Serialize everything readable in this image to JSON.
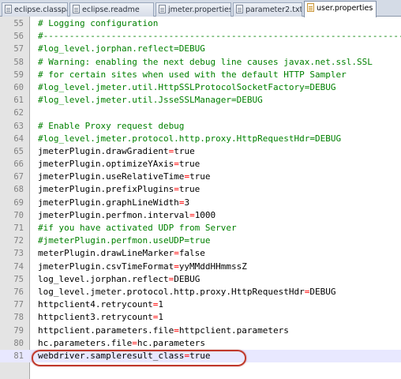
{
  "tabs": [
    {
      "label": "eclipse.classpath",
      "icon": "text-file-icon"
    },
    {
      "label": "eclipse.readme",
      "icon": "text-file-icon"
    },
    {
      "label": "jmeter.properties",
      "icon": "text-file-icon"
    },
    {
      "label": "parameter2.txt",
      "icon": "text-file-icon"
    },
    {
      "label": "user.properties",
      "icon": "properties-file-icon",
      "active": true
    }
  ],
  "colors": {
    "comment": "#008000",
    "equals": "#ff0000",
    "line_number": "#808080",
    "highlight_ring": "#c0392b"
  },
  "lines": [
    {
      "num": "55",
      "type": "comment",
      "text": "# Logging configuration"
    },
    {
      "num": "56",
      "type": "comment",
      "text": "#-----------------------------------------------------------------------"
    },
    {
      "num": "57",
      "type": "comment",
      "text": "#log_level.jorphan.reflect=DEBUG"
    },
    {
      "num": "58",
      "type": "comment",
      "text": "# Warning: enabling the next debug line causes javax.net.ssl.SSL"
    },
    {
      "num": "59",
      "type": "comment",
      "text": "# for certain sites when used with the default HTTP Sampler"
    },
    {
      "num": "60",
      "type": "comment",
      "text": "#log_level.jmeter.util.HttpSSLProtocolSocketFactory=DEBUG"
    },
    {
      "num": "61",
      "type": "comment",
      "text": "#log_level.jmeter.util.JsseSSLManager=DEBUG"
    },
    {
      "num": "62",
      "type": "blank",
      "text": ""
    },
    {
      "num": "63",
      "type": "comment",
      "text": "# Enable Proxy request debug"
    },
    {
      "num": "64",
      "type": "comment",
      "text": "#log_level.jmeter.protocol.http.proxy.HttpRequestHdr=DEBUG"
    },
    {
      "num": "65",
      "type": "prop",
      "key": "jmeterPlugin.drawGradient",
      "value": "true"
    },
    {
      "num": "66",
      "type": "prop",
      "key": "jmeterPlugin.optimizeYAxis",
      "value": "true"
    },
    {
      "num": "67",
      "type": "prop",
      "key": "jmeterPlugin.useRelativeTime",
      "value": "true"
    },
    {
      "num": "68",
      "type": "prop",
      "key": "jmeterPlugin.prefixPlugins",
      "value": "true"
    },
    {
      "num": "69",
      "type": "prop",
      "key": "jmeterPlugin.graphLineWidth",
      "value": "3"
    },
    {
      "num": "70",
      "type": "prop",
      "key": "jmeterPlugin.perfmon.interval",
      "value": "1000"
    },
    {
      "num": "71",
      "type": "comment",
      "text": "#if you have activated UDP from Server"
    },
    {
      "num": "72",
      "type": "comment",
      "text": "#jmeterPlugin.perfmon.useUDP=true"
    },
    {
      "num": "73",
      "type": "prop",
      "key": "meterPlugin.drawLineMarker",
      "value": "false"
    },
    {
      "num": "74",
      "type": "prop",
      "key": "jmeterPlugin.csvTimeFormat",
      "value": "yyMMddHHmmssZ"
    },
    {
      "num": "75",
      "type": "prop",
      "key": "log_level.jorphan.reflect",
      "value": "DEBUG"
    },
    {
      "num": "76",
      "type": "prop",
      "key": "log_level.jmeter.protocol.http.proxy.HttpRequestHdr",
      "value": "DEBUG"
    },
    {
      "num": "77",
      "type": "prop",
      "key": "httpclient4.retrycount",
      "value": "1"
    },
    {
      "num": "78",
      "type": "prop",
      "key": "httpclient3.retrycount",
      "value": "1"
    },
    {
      "num": "79",
      "type": "prop",
      "key": "httpclient.parameters.file",
      "value": "httpclient.parameters"
    },
    {
      "num": "80",
      "type": "prop",
      "key": "hc.parameters.file",
      "value": "hc.parameters"
    },
    {
      "num": "81",
      "type": "prop",
      "key": "webdriver.sampleresult_class",
      "value": "true",
      "current": true
    }
  ]
}
